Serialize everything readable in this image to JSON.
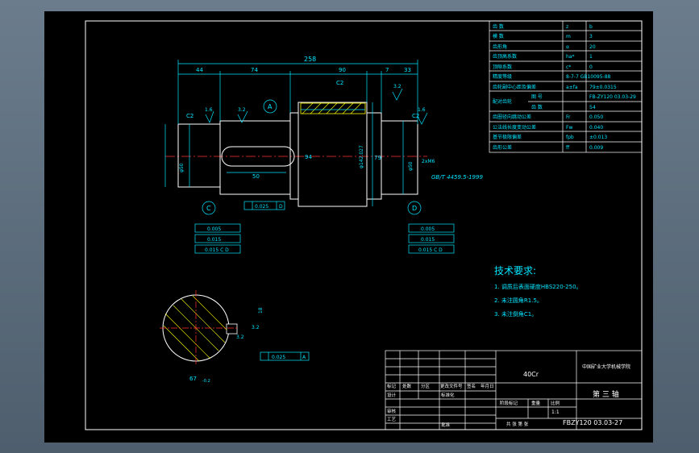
{
  "drawing": {
    "dims": {
      "overall": "258",
      "d44": "44",
      "d74": "74",
      "d90": "90",
      "d7": "7",
      "d33": "33",
      "d50": "50",
      "d94": "94",
      "d79": "79",
      "dphi": "φ142.027",
      "dsmall": "φ50",
      "dright": "φ50",
      "c2a": "C2",
      "c2b": "C2",
      "c2c": "C2",
      "r16a": "1.6",
      "r32a": "3.2",
      "r32b": "3.2",
      "r16b": "1.6",
      "label_A": "A",
      "label_C": "C",
      "label_D": "D",
      "hole_note": "2xM6",
      "gb_note": "GB/T 4459.5-1999",
      "tol_mid": "0.025",
      "tol_mid_ref": "D",
      "secA_dim": "67",
      "secA_sub": "-0.2",
      "secA_w": "18",
      "secA_r": "3.2",
      "secA_r2": "3.2",
      "secA_tol": "0.025",
      "secA_ref": "A",
      "lstack": [
        "0.005",
        "0.015",
        "0.015 C D"
      ],
      "rstack": [
        "0.005",
        "0.015",
        "0.015 C D"
      ]
    },
    "param_table": [
      {
        "name": "齿  数",
        "sym": "z",
        "val": "b"
      },
      {
        "name": "模  数",
        "sym": "m",
        "val": "3"
      },
      {
        "name": "齿形角",
        "sym": "α",
        "val": "20"
      },
      {
        "name": "齿顶高系数",
        "sym": "ha*",
        "val": "1"
      },
      {
        "name": "顶隙系数",
        "sym": "c*",
        "val": "0"
      },
      {
        "name": "精度等级",
        "sym": "",
        "val": "8-7-7 GB10095-88"
      },
      {
        "name": "齿轮副中心距及偏差",
        "sym": "a±fa",
        "val": "79±0.0315"
      },
      {
        "name": "配对齿轮",
        "sym": "图  号",
        "val": "FB-ZY120 03.03-29"
      },
      {
        "name": "",
        "sym": "齿  数",
        "val": "54"
      },
      {
        "name": "齿圈径向跳动公差",
        "sym": "Fr",
        "val": "0.050"
      },
      {
        "name": "公法线长度变动公差",
        "sym": "Fw",
        "val": "0.040"
      },
      {
        "name": "基节极限偏差",
        "sym": "fpb",
        "val": "±0.013"
      },
      {
        "name": "齿形公差",
        "sym": "ff",
        "val": "0.009"
      }
    ],
    "tech": {
      "title": "技术要求:",
      "items": [
        "1. 调质后表面硬度HBS220-250。",
        "2. 未注圆角R1.5。",
        "3. 未注倒角C1。"
      ]
    },
    "title_block": {
      "material": "40Cr",
      "school": "中国矿业大学机械学院",
      "part_name": "第 三 轴",
      "drawing_no": "FBZY120 03.03-27",
      "scale": "1:1",
      "headers": [
        "标记",
        "处数",
        "分区",
        "更改文件号",
        "签名",
        "年月日"
      ],
      "rows": [
        "设计",
        "标准化",
        "审核",
        "工艺",
        "批准"
      ],
      "stage": "阶段标记",
      "weight": "重量",
      "ratio": "比例",
      "sheets": "共  张  第  张"
    }
  }
}
